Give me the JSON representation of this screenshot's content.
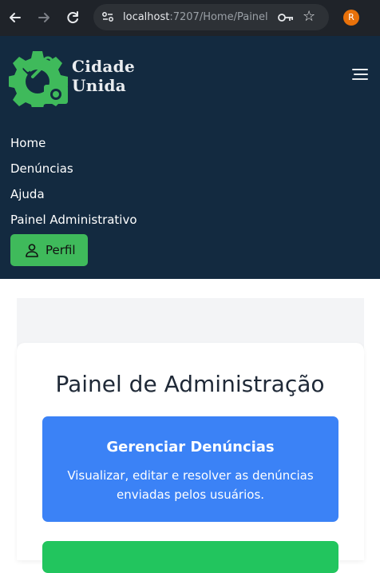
{
  "browser": {
    "url_host": "localhost",
    "url_path": ":7207/Home/Painel",
    "profile_initial": "R",
    "icons": [
      "back-arrow-icon",
      "forward-arrow-icon",
      "reload-icon",
      "site-settings-icon",
      "password-key-icon",
      "bookmark-star-icon"
    ]
  },
  "header": {
    "brand_line1": "Cidade",
    "brand_line2": "Unida",
    "menu": {
      "home": "Home",
      "denuncias": "Denúncias",
      "ajuda": "Ajuda",
      "painel": "Painel Administrativo"
    },
    "perfil_label": "Perfil"
  },
  "main": {
    "title": "Painel de Administração",
    "cards": [
      {
        "title": "Gerenciar Denúncias",
        "description": "Visualizar, editar e resolver as denúncias enviadas pelos usuários."
      }
    ]
  },
  "colors": {
    "header_bg": "#132a40",
    "accent_green": "#3fba5b",
    "card_blue": "#3b82f6",
    "card_green": "#22c55e"
  }
}
